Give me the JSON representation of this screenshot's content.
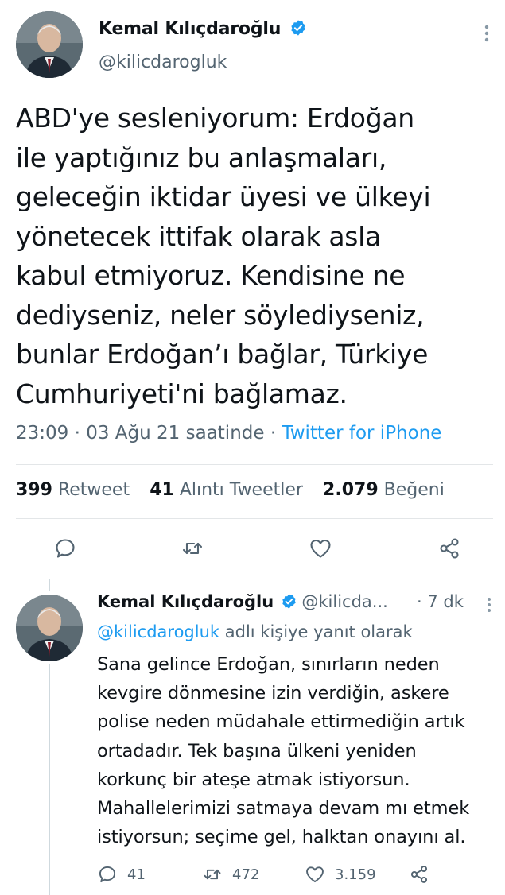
{
  "tweet": {
    "author_name": "Kemal Kılıçdaroğlu",
    "author_handle": "@kilicdarogluk",
    "text": "ABD'ye sesleniyorum: Erdoğan\nile yaptığınız bu anlaşmaları,\ngeleceğin iktidar üyesi ve ülkeyi\nyönetecek ittifak olarak asla\nkabul etmiyoruz. Kendisine ne\ndediyseniz, neler söylediyseniz,\nbunlar Erdoğan’ı bağlar, Türkiye\nCumhuriyeti'ni bağlamaz.",
    "time": "23:09",
    "date": "03 Ağu 21 saatinde",
    "sep": "·",
    "source": "Twitter for iPhone",
    "stats": {
      "retweets": "399",
      "retweets_label": "Retweet",
      "quotes": "41",
      "quotes_label": "Alıntı Tweetler",
      "likes": "2.079",
      "likes_label": "Beğeni"
    }
  },
  "reply": {
    "author_name": "Kemal Kılıçdaroğlu",
    "author_handle": "@kilicda...",
    "age": "7 dk",
    "sep": "·",
    "mention": "@kilicdarogluk",
    "replying_suffix": "adlı kişiye yanıt olarak",
    "text": "Sana gelince Erdoğan, sınırların neden\nkevgire dönmesine izin verdiğin, askere\npolise neden müdahale ettirmediğin artık\nortadadır. Tek başına ülkeni yeniden\nkorkunç bir ateşe atmak istiyorsun.\nMahallelerimizi satmaya devam mı etmek\nistiyorsun; seçime gel, halktan onayını al.",
    "counts": {
      "replies": "41",
      "retweets": "472",
      "likes": "3.159"
    }
  },
  "colors": {
    "accent": "#1d9bf0",
    "muted": "#536471",
    "text": "#0f1419",
    "divider": "#e3e6e8"
  },
  "icons": [
    "verified-badge-icon",
    "more-options-icon",
    "reply-icon",
    "retweet-icon",
    "like-icon",
    "share-icon"
  ]
}
